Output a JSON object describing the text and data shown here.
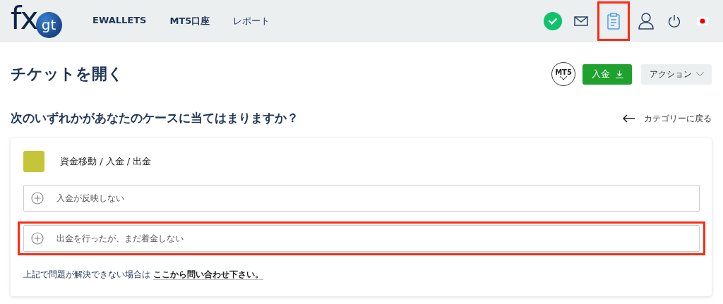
{
  "header": {
    "logo": {
      "text": "fx",
      "badge": "gt"
    },
    "nav": [
      {
        "label": "EWALLETS",
        "bold": true
      },
      {
        "label": "MT5口座",
        "bold": true
      },
      {
        "label": "レポート",
        "bold": false
      }
    ],
    "icons": [
      {
        "kind": "verified",
        "highlighted": false
      },
      {
        "kind": "mail",
        "highlighted": false,
        "active": false
      },
      {
        "kind": "clipboard",
        "highlighted": true,
        "active": true
      },
      {
        "kind": "user",
        "highlighted": false,
        "active": false
      },
      {
        "kind": "power",
        "highlighted": false,
        "active": false
      },
      {
        "kind": "flag",
        "highlighted": false
      }
    ]
  },
  "page": {
    "title": "チケットを開く",
    "platform": "MT5",
    "deposit_button": "入金",
    "action_button": "アクション"
  },
  "question": "次のいずれかがあなたのケースに当てはまりますか？",
  "back_link": "カテゴリーに戻る",
  "category": {
    "label": "資金移動 / 入金 / 出金",
    "color": "#c5c53a",
    "items": [
      {
        "label": "入金が反映しない",
        "highlighted": false
      },
      {
        "label": "出金を行ったが、まだ着金しない",
        "highlighted": true
      }
    ]
  },
  "footer": {
    "text": "上記で問題が解決できない場合は",
    "link": "ここから問い合わせ下さい。"
  }
}
